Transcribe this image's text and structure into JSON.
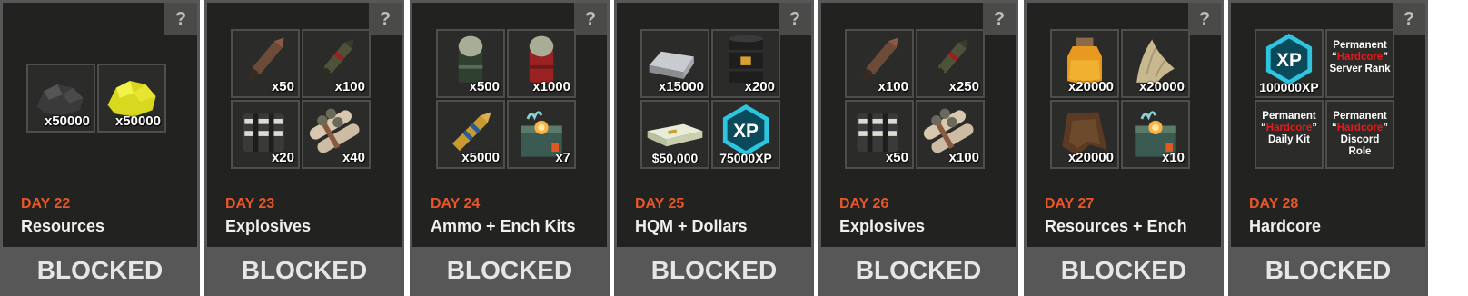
{
  "help_label": "?",
  "status_label": "BLOCKED",
  "cards": [
    {
      "day": "DAY 22",
      "title": "Resources",
      "items": [
        {
          "icon": "coal-ore-icon",
          "qty": "x50000"
        },
        {
          "icon": "sulfur-ore-icon",
          "qty": "x50000"
        }
      ]
    },
    {
      "day": "DAY 23",
      "title": "Explosives",
      "items": [
        {
          "icon": "rocket-icon",
          "qty": "x50"
        },
        {
          "icon": "hv-rocket-icon",
          "qty": "x100"
        },
        {
          "icon": "satchel-charge-icon",
          "qty": "x20"
        },
        {
          "icon": "c4-explosive-icon",
          "qty": "x40"
        }
      ]
    },
    {
      "day": "DAY 24",
      "title": "Ammo + Ench Kits",
      "items": [
        {
          "icon": "grenade-round-icon",
          "qty": "x500"
        },
        {
          "icon": "red-grenade-round-icon",
          "qty": "x1000"
        },
        {
          "icon": "rifle-ammo-icon",
          "qty": "x5000"
        },
        {
          "icon": "enchant-kit-icon",
          "qty": "x7"
        }
      ]
    },
    {
      "day": "DAY 25",
      "title": "HQM + Dollars",
      "items": [
        {
          "icon": "hqm-ingot-icon",
          "qty": "x15000"
        },
        {
          "icon": "oil-barrel-icon",
          "qty": "x200"
        },
        {
          "icon": "cash-stack-icon",
          "qty": "$50,000"
        },
        {
          "icon": "xp-badge-icon",
          "qty": "75000XP"
        }
      ]
    },
    {
      "day": "DAY 26",
      "title": "Explosives",
      "items": [
        {
          "icon": "rocket-icon",
          "qty": "x100"
        },
        {
          "icon": "hv-rocket-icon",
          "qty": "x250"
        },
        {
          "icon": "satchel-charge-icon",
          "qty": "x50"
        },
        {
          "icon": "c4-explosive-icon",
          "qty": "x100"
        }
      ]
    },
    {
      "day": "DAY 27",
      "title": "Resources + Ench",
      "items": [
        {
          "icon": "potion-jar-icon",
          "qty": "x20000"
        },
        {
          "icon": "cloth-icon",
          "qty": "x20000"
        },
        {
          "icon": "leather-icon",
          "qty": "x20000"
        },
        {
          "icon": "enchant-kit-icon",
          "qty": "x10"
        }
      ]
    },
    {
      "day": "DAY 28",
      "title": "Hardcore",
      "items": [
        {
          "icon": "xp-badge-icon",
          "qty": "100000XP"
        },
        {
          "perk": true,
          "l1": "Permanent",
          "hl": "Hardcore",
          "l3": "Server Rank"
        },
        {
          "perk": true,
          "l1": "Permanent",
          "hl": "Hardcore",
          "l3": "Daily Kit"
        },
        {
          "perk": true,
          "l1": "Permanent",
          "hl": "Hardcore",
          "l3": "Discord Role"
        }
      ]
    }
  ],
  "colors": {
    "day_accent": "#e8562a",
    "hardcore_red": "#e8191b",
    "xp_cyan": "#2ec5e0"
  }
}
